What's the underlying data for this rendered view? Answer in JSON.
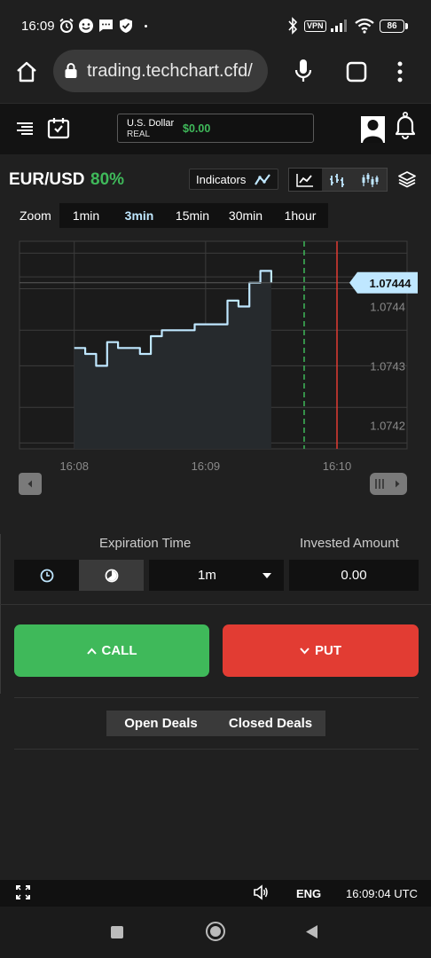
{
  "status": {
    "time": "16:09",
    "vpn": "VPN",
    "battery": "86"
  },
  "browser": {
    "url": "trading.techchart.cfd/"
  },
  "account": {
    "currency": "U.S. Dollar",
    "type": "REAL",
    "balance": "$0.00"
  },
  "asset": {
    "pair": "EUR/USD",
    "payout": "80%"
  },
  "toolbar": {
    "indicators_label": "Indicators"
  },
  "zoom": {
    "label": "Zoom",
    "options": [
      "1min",
      "3min",
      "15min",
      "30min",
      "1hour"
    ],
    "selected": "3min"
  },
  "chart_data": {
    "type": "line",
    "x": [
      "16:08:00",
      "16:08:05",
      "16:08:10",
      "16:08:15",
      "16:08:20",
      "16:08:25",
      "16:08:30",
      "16:08:35",
      "16:08:40",
      "16:08:45",
      "16:08:50",
      "16:08:55",
      "16:09:00",
      "16:09:05",
      "16:09:10",
      "16:09:15",
      "16:09:20",
      "16:09:25",
      "16:09:30",
      "16:09:35",
      "16:09:40",
      "16:09:45",
      "16:09:50",
      "16:09:55",
      "16:10:00",
      "16:10:05",
      "16:10:10"
    ],
    "xtick_labels": [
      "16:08",
      "16:09",
      "16:10"
    ],
    "series": [
      {
        "values": [
          1.07433,
          1.07432,
          1.0743,
          1.07434,
          1.07433,
          1.07433,
          1.07432,
          1.07435,
          1.07436,
          1.07436,
          1.07436,
          1.07437,
          1.07437,
          1.07437,
          1.07441,
          1.0744,
          1.07444,
          1.07446,
          1.07444
        ]
      }
    ],
    "current_value": "1.07444",
    "ytick_labels": [
      "1.0744",
      "1.0743",
      "1.0742"
    ],
    "ylim": [
      1.07416,
      1.07451
    ],
    "grid": true,
    "expiration_marker": "16:09:45",
    "deadline_marker": "16:10:00"
  },
  "trade": {
    "expiration_label": "Expiration Time",
    "invested_label": "Invested Amount",
    "duration": "1m",
    "amount": "0.00",
    "call_label": "CALL",
    "put_label": "PUT"
  },
  "deals": {
    "open_label": "Open Deals",
    "closed_label": "Closed Deals"
  },
  "footer": {
    "language": "ENG",
    "clock": "16:09:04 UTC"
  },
  "colors": {
    "accent_green": "#3fb95a",
    "put_red": "#e23c33",
    "line": "#bfe7ff",
    "price_tag": "#bfe7ff"
  }
}
